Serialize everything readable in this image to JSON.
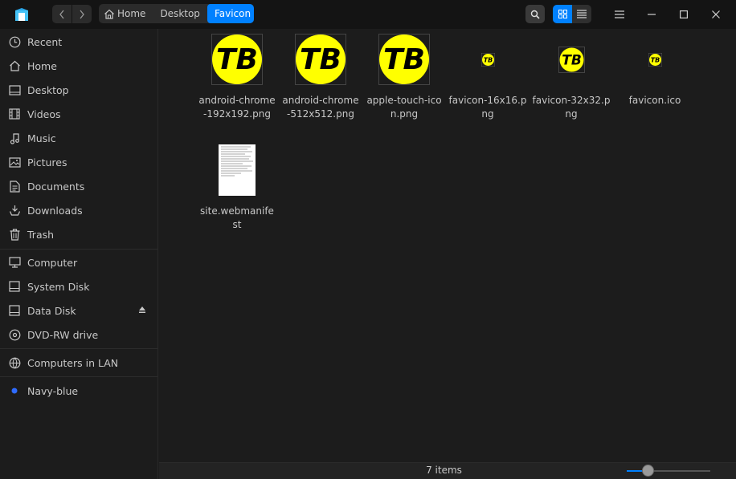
{
  "titlebar": {
    "breadcrumbs": [
      "Home",
      "Desktop",
      "Favicon"
    ]
  },
  "sidebar": {
    "items": [
      {
        "label": "Recent",
        "icon": "clock-icon"
      },
      {
        "label": "Home",
        "icon": "home-icon"
      },
      {
        "label": "Desktop",
        "icon": "desktop-icon"
      },
      {
        "label": "Videos",
        "icon": "film-icon"
      },
      {
        "label": "Music",
        "icon": "music-note-icon"
      },
      {
        "label": "Pictures",
        "icon": "image-icon"
      },
      {
        "label": "Documents",
        "icon": "document-icon"
      },
      {
        "label": "Downloads",
        "icon": "download-icon"
      },
      {
        "label": "Trash",
        "icon": "trash-icon"
      }
    ],
    "devices": [
      {
        "label": "Computer",
        "icon": "monitor-icon"
      },
      {
        "label": "System Disk",
        "icon": "disk-icon"
      },
      {
        "label": "Data Disk",
        "icon": "disk-icon"
      },
      {
        "label": "DVD-RW drive",
        "icon": "disc-icon"
      }
    ],
    "network": [
      {
        "label": "Computers in LAN",
        "icon": "globe-icon"
      }
    ],
    "tags": [
      {
        "label": "Navy-blue",
        "color": "#2f6bff"
      }
    ]
  },
  "files": [
    {
      "name": "android-chrome-192x192.png",
      "kind": "tb-large"
    },
    {
      "name": "android-chrome-512x512.png",
      "kind": "tb-large"
    },
    {
      "name": "apple-touch-icon.png",
      "kind": "tb-large"
    },
    {
      "name": "favicon-16x16.png",
      "kind": "tb-tiny"
    },
    {
      "name": "favicon-32x32.png",
      "kind": "tb-small"
    },
    {
      "name": "favicon.ico",
      "kind": "tb-tiny"
    },
    {
      "name": "site.webmanifest",
      "kind": "text-doc"
    }
  ],
  "thumbnail": {
    "text": "TB",
    "circle_color": "#ffff00",
    "text_color": "#000000"
  },
  "status": {
    "item_count": "7 items",
    "zoom_level": 0.26
  },
  "colors": {
    "accent": "#0081ff",
    "background": "#1c1c1c",
    "titlebar": "#141414"
  }
}
